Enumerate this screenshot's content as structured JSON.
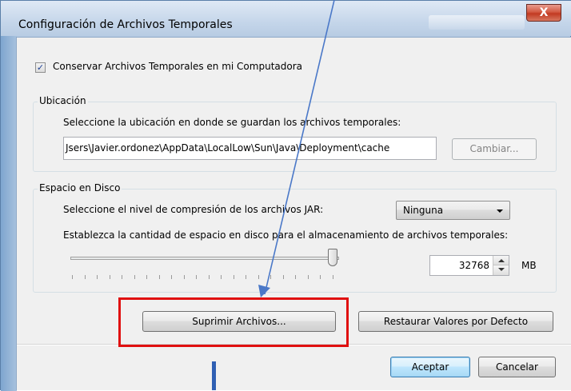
{
  "window": {
    "title": "Configuración de Archivos Temporales",
    "close_glyph": "X"
  },
  "keep_files": {
    "label": "Conservar Archivos Temporales en mi Computadora",
    "checked": true,
    "check_glyph": "✓"
  },
  "location": {
    "legend": "Ubicación",
    "prompt": "Seleccione la ubicación en donde se guardan los archivos temporales:",
    "path": "Jsers\\Javier.ordonez\\AppData\\LocalLow\\Sun\\Java\\Deployment\\cache",
    "change_button": "Cambiar..."
  },
  "disk": {
    "legend": "Espacio en Disco",
    "compression_prompt": "Seleccione el nivel de compresión de los archivos JAR:",
    "compression_value": "Ninguna",
    "space_prompt": "Establezca la cantidad de espacio en disco para el almacenamiento de archivos temporales:",
    "slider_fraction": 1.0,
    "space_value": "32768",
    "unit": "MB"
  },
  "actions": {
    "delete_files": "Suprimir Archivos...",
    "restore_defaults": "Restaurar Valores por Defecto"
  },
  "footer": {
    "ok": "Aceptar",
    "cancel": "Cancelar"
  },
  "colors": {
    "highlight": "#e01010",
    "arrow": "#4a78c8",
    "bar": "#2f5fb3"
  }
}
